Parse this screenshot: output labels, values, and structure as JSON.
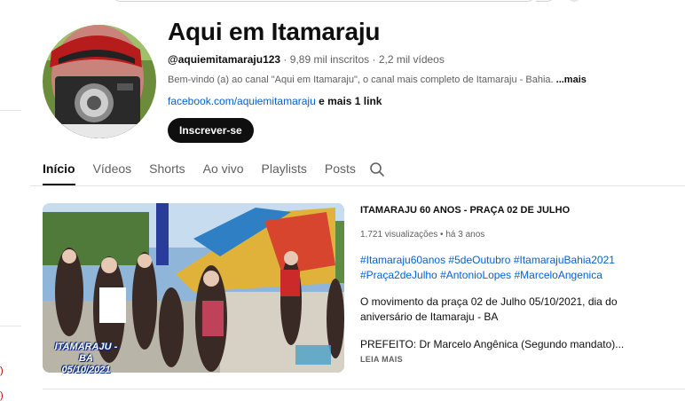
{
  "channel": {
    "name": "Aqui em Itamaraju",
    "handle": "@aquiemitamaraju123",
    "subscribers": "9,89 mil inscritos",
    "videos": "2,2 mil vídeos",
    "separator": " · ",
    "description": "Bem-vindo (a) ao canal \"Aqui em Itamaraju\", o canal mais completo de Itamaraju - Bahia.",
    "description_more": "...mais",
    "link": "facebook.com/aquiemitamaraju",
    "link_extra": " e mais 1 link",
    "subscribe_label": "Inscrever-se"
  },
  "tabs": [
    {
      "label": "Início",
      "active": true
    },
    {
      "label": "Vídeos"
    },
    {
      "label": "Shorts"
    },
    {
      "label": "Ao vivo"
    },
    {
      "label": "Playlists"
    },
    {
      "label": "Posts"
    }
  ],
  "featured_video": {
    "title": "ITAMARAJU 60 ANOS - PRAÇA 02 DE JULHO",
    "views": "1.721 visualizações",
    "age": "há 3 anos",
    "hashtags": [
      "#Itamaraju60anos",
      "#5deOutubro",
      "#ItamarajuBahia2021",
      "#Praça2deJulho",
      "#AntonioLopes",
      "#MarceloAngenica"
    ],
    "description": "O movimento da praça 02 de Julho 05/10/2021, dia do aniversário de Itamaraju - BA",
    "description_extra": "PREFEITO: Dr Marcelo Angênica (Segundo mandato)...",
    "read_more": "LEIA MAIS",
    "thumbnail_caption_line1": "ITAMARAJU - BA",
    "thumbnail_caption_line2": "05/10/2021"
  },
  "icons": {
    "tab_search": "search-icon"
  },
  "colors": {
    "link": "#065fd4",
    "subscribe_bg": "#0f0f0f",
    "text_secondary": "#606060"
  }
}
